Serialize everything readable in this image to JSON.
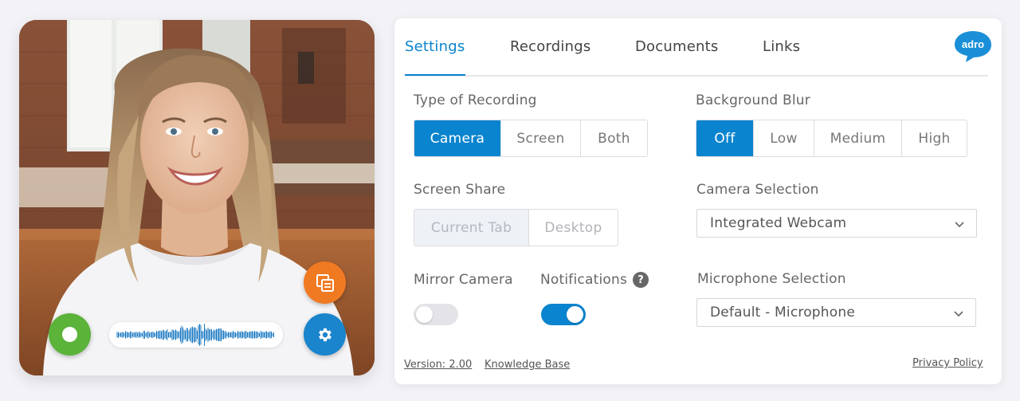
{
  "tabs": [
    {
      "label": "Settings",
      "active": true
    },
    {
      "label": "Recordings",
      "active": false
    },
    {
      "label": "Documents",
      "active": false
    },
    {
      "label": "Links",
      "active": false
    }
  ],
  "brand": {
    "logo_text": "adro",
    "color": "#1a8fd8"
  },
  "recording_type": {
    "label": "Type of Recording",
    "options": [
      "Camera",
      "Screen",
      "Both"
    ],
    "selected": "Camera"
  },
  "background_blur": {
    "label": "Background Blur",
    "options": [
      "Off",
      "Low",
      "Medium",
      "High"
    ],
    "selected": "Off"
  },
  "screen_share": {
    "label": "Screen Share",
    "options": [
      "Current Tab",
      "Desktop"
    ],
    "selected": "Current Tab",
    "disabled": true
  },
  "camera_selection": {
    "label": "Camera Selection",
    "value": "Integrated Webcam"
  },
  "microphone_selection": {
    "label": "Microphone Selection",
    "value": "Default - Microphone"
  },
  "mirror_camera": {
    "label": "Mirror Camera",
    "on": false
  },
  "notifications": {
    "label": "Notifications",
    "on": true,
    "help": "?"
  },
  "footer": {
    "version": "Version: 2.00",
    "knowledge_base": "Knowledge Base",
    "privacy": "Privacy Policy"
  },
  "colors": {
    "accent": "#0a84ce",
    "record": "#5bb33a",
    "share": "#f07a22",
    "settings": "#1a84cc"
  },
  "camera_controls": {
    "record_icon": "record-icon",
    "share_icon": "screen-share-icon",
    "settings_icon": "gear-icon"
  }
}
